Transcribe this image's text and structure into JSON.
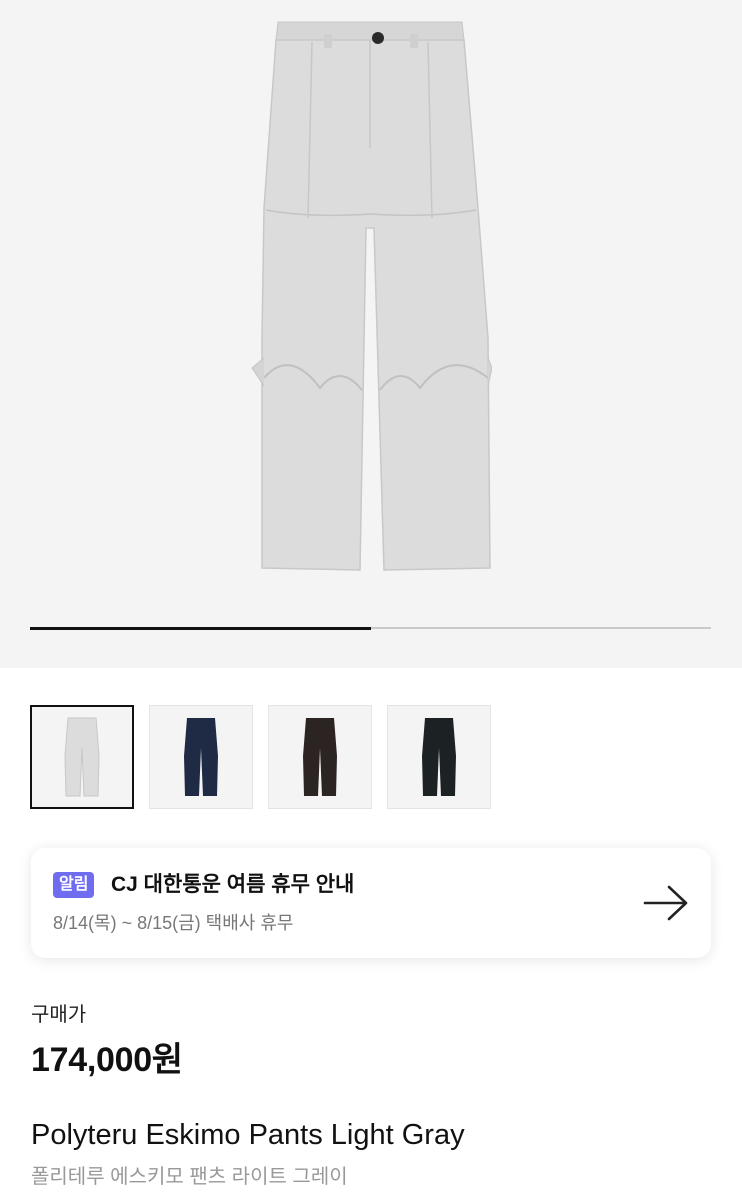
{
  "gallery": {
    "progress": 0.5,
    "thumbnails": [
      {
        "color_name": "Light Gray",
        "color": "#dcdcdc",
        "selected": true
      },
      {
        "color_name": "Navy",
        "color": "#1f2a44",
        "selected": false
      },
      {
        "color_name": "Brown",
        "color": "#2b2422",
        "selected": false
      },
      {
        "color_name": "Black",
        "color": "#1c2124",
        "selected": false
      }
    ]
  },
  "notice": {
    "badge": "알림",
    "title": "CJ 대한통운 여름 휴무 안내",
    "subtitle": "8/14(목) ~ 8/15(금) 택배사 휴무",
    "icon": "arrow-right-icon"
  },
  "price": {
    "label": "구매가",
    "value": "174,000원"
  },
  "product": {
    "name_en": "Polyteru Eskimo Pants Light Gray",
    "name_ko": "폴리테루 에스키모 팬츠 라이트 그레이"
  },
  "colors": {
    "accent": "#6f6cf0",
    "hero_bg": "#f4f4f4",
    "pants_main": "#dcdcdc"
  }
}
